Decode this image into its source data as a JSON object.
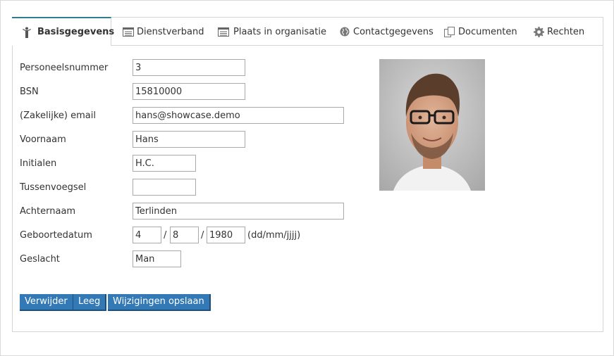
{
  "tabs": [
    {
      "label": "Basisgegevens",
      "icon": "person-icon",
      "active": true
    },
    {
      "label": "Dienstverband",
      "icon": "list-card-icon",
      "active": false
    },
    {
      "label": "Plaats in organisatie",
      "icon": "list-card-icon",
      "active": false
    },
    {
      "label": "Contactgegevens",
      "icon": "globe-icon",
      "active": false
    },
    {
      "label": "Documenten",
      "icon": "documents-icon",
      "active": false
    },
    {
      "label": "Rechten",
      "icon": "gear-icon",
      "active": false
    }
  ],
  "form": {
    "personeelsnummer": {
      "label": "Personeelsnummer",
      "value": "3"
    },
    "bsn": {
      "label": "BSN",
      "value": "15810000"
    },
    "email": {
      "label": "(Zakelijke) email",
      "value": "hans@showcase.demo"
    },
    "voornaam": {
      "label": "Voornaam",
      "value": "Hans"
    },
    "initialen": {
      "label": "Initialen",
      "value": "H.C."
    },
    "tussenvoegsel": {
      "label": "Tussenvoegsel",
      "value": ""
    },
    "achternaam": {
      "label": "Achternaam",
      "value": "Terlinden"
    },
    "geboortedatum": {
      "label": "Geboortedatum",
      "day": "4",
      "month": "8",
      "year": "1980",
      "separator": "/",
      "format_hint": "(dd/mm/jjjj)"
    },
    "geslacht": {
      "label": "Geslacht",
      "value": "Man"
    }
  },
  "buttons": {
    "delete": "Verwijder",
    "clear": "Leeg",
    "save": "Wijzigingen opslaan"
  },
  "colors": {
    "button_bg": "#3279b5",
    "active_tab_accent": "#2e7d88",
    "icon_gray": "#666666"
  }
}
